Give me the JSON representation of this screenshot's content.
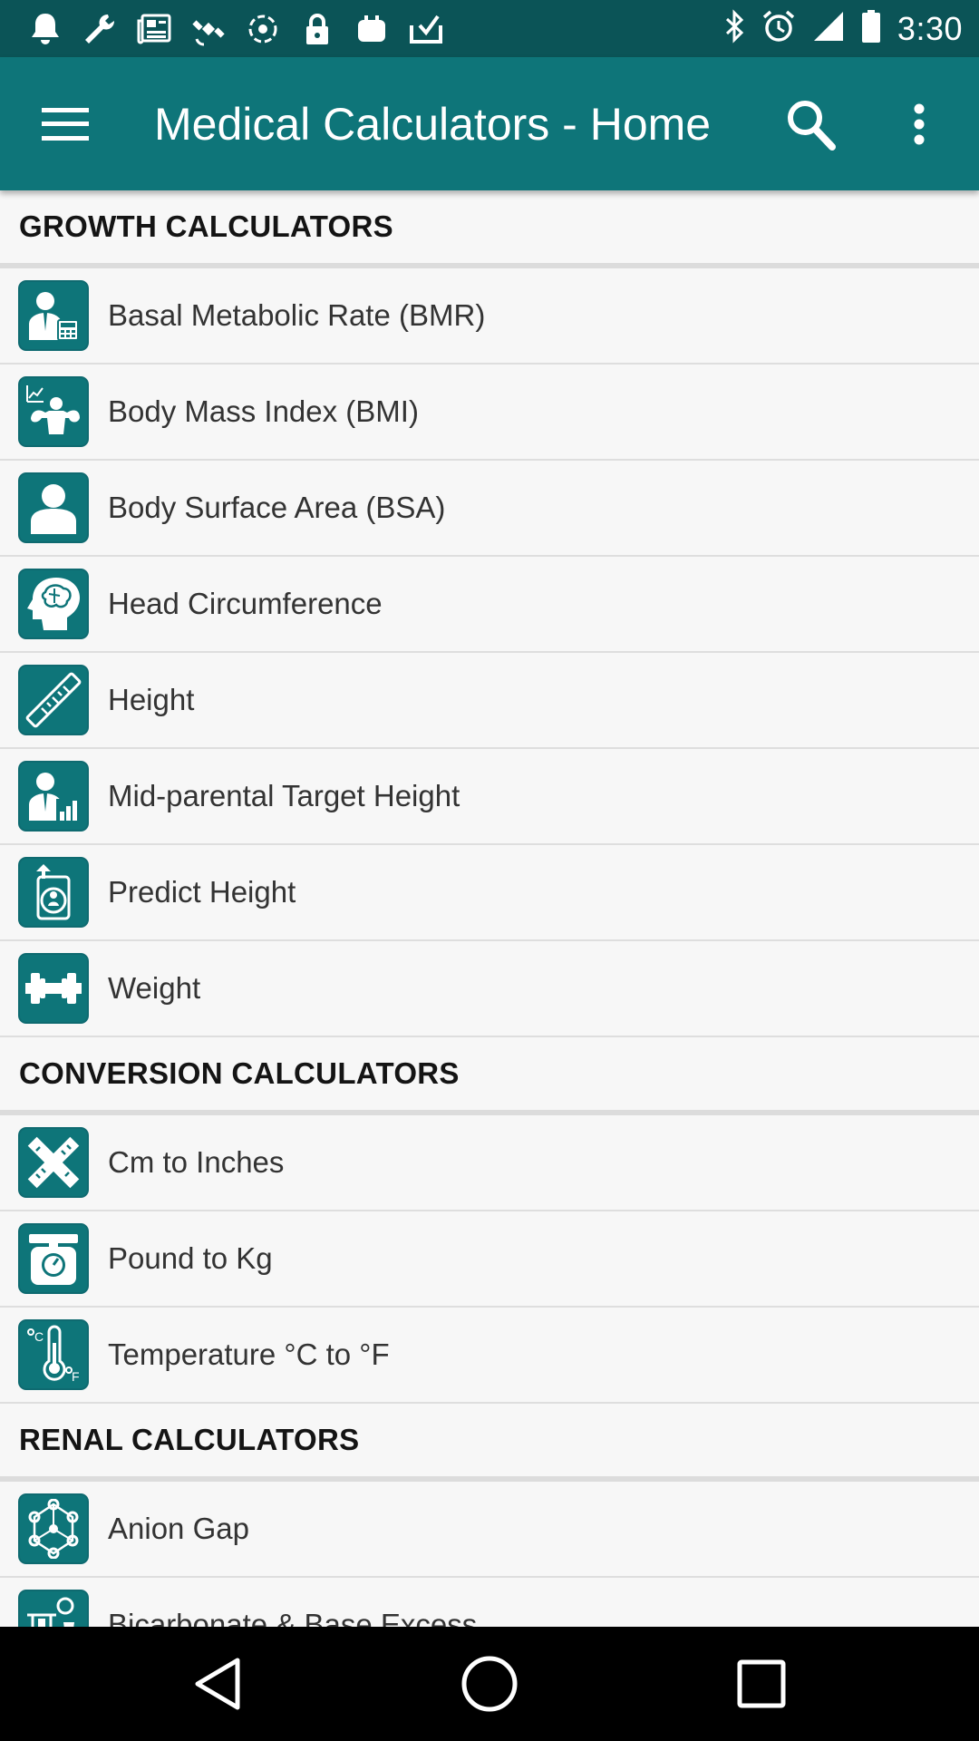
{
  "status_bar": {
    "time": "3:30",
    "left_icons": [
      "notification-icon",
      "wrench-icon",
      "newspaper-icon",
      "satellite-icon",
      "sync-icon",
      "lock-icon",
      "app-icon",
      "download-icon"
    ],
    "right_icons": [
      "bluetooth-icon",
      "alarm-icon",
      "signal-icon",
      "battery-icon"
    ]
  },
  "app_bar": {
    "title": "Medical Calculators - Home",
    "menu_icon": "hamburger-menu-icon",
    "search_icon": "search-icon",
    "overflow_icon": "more-vert-icon"
  },
  "sections": [
    {
      "title": "GROWTH CALCULATORS",
      "items": [
        {
          "label": "Basal Metabolic Rate (BMR)",
          "icon": "person-calculator-icon"
        },
        {
          "label": "Body Mass Index (BMI)",
          "icon": "muscle-chart-icon"
        },
        {
          "label": "Body Surface Area (BSA)",
          "icon": "person-icon"
        },
        {
          "label": "Head Circumference",
          "icon": "head-brain-icon"
        },
        {
          "label": "Height",
          "icon": "ruler-icon"
        },
        {
          "label": "Mid-parental Target Height",
          "icon": "person-bars-icon"
        },
        {
          "label": "Predict Height",
          "icon": "baby-arrow-icon"
        },
        {
          "label": "Weight",
          "icon": "dumbbell-icon"
        }
      ]
    },
    {
      "title": "CONVERSION CALCULATORS",
      "items": [
        {
          "label": "Cm to Inches",
          "icon": "crossed-rulers-icon"
        },
        {
          "label": "Pound to Kg",
          "icon": "weighing-scale-icon"
        },
        {
          "label": "Temperature °C to °F",
          "icon": "thermometer-icon"
        }
      ]
    },
    {
      "title": "RENAL CALCULATORS",
      "items": [
        {
          "label": "Anion Gap",
          "icon": "molecule-icon"
        },
        {
          "label": "Bicarbonate & Base Excess",
          "icon": "lab-equipment-icon"
        }
      ]
    }
  ],
  "nav_bar": {
    "back_icon": "back-triangle-icon",
    "home_icon": "home-circle-icon",
    "recents_icon": "recents-square-icon"
  },
  "colors": {
    "status_bar": "#0b5457",
    "app_bar": "#0e7579",
    "accent": "#0e7579",
    "background": "#f7f7f7"
  }
}
